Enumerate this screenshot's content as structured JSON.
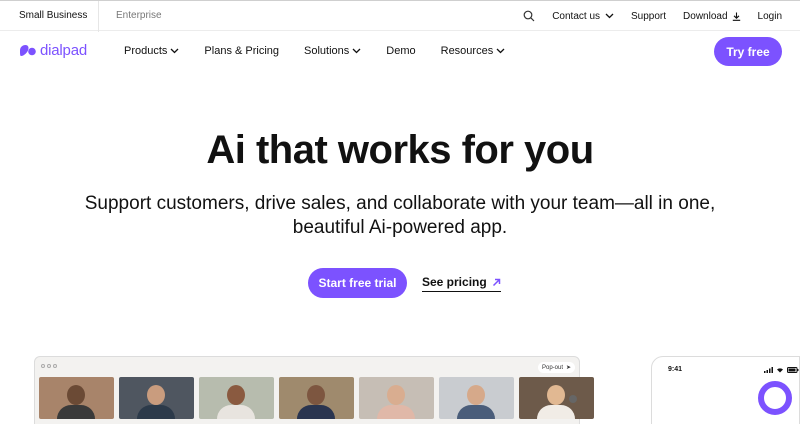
{
  "topbar": {
    "segments": [
      "Small Business",
      "Enterprise"
    ],
    "contact_label": "Contact us",
    "support_label": "Support",
    "download_label": "Download",
    "login_label": "Login"
  },
  "nav": {
    "brand": "dialpad",
    "items": [
      {
        "label": "Products",
        "has_menu": true
      },
      {
        "label": "Plans & Pricing",
        "has_menu": false
      },
      {
        "label": "Solutions",
        "has_menu": true
      },
      {
        "label": "Demo",
        "has_menu": false
      },
      {
        "label": "Resources",
        "has_menu": true
      }
    ],
    "cta_label": "Try free"
  },
  "hero": {
    "title": "Ai that works for you",
    "subtitle": "Support customers, drive sales, and collaborate with your team—all in one, beautiful Ai-powered app.",
    "primary_cta": "Start free trial",
    "secondary_cta": "See pricing"
  },
  "app_preview": {
    "popout_label": "Pop-out",
    "tile_count": 7
  },
  "phone_preview": {
    "time": "9:41"
  },
  "colors": {
    "brand": "#7c52ff",
    "text": "#111111",
    "muted": "#777777"
  },
  "icons": [
    "search-icon",
    "chevron-down-icon",
    "download-icon",
    "arrow-up-right-icon",
    "dialpad-logo-icon"
  ]
}
